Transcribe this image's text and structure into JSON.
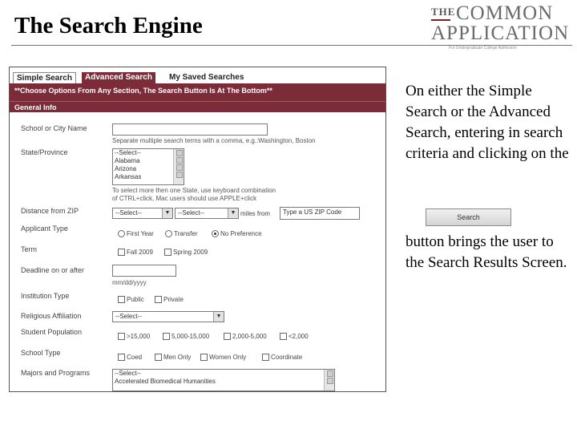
{
  "slide": {
    "title": "The Search Engine",
    "body_part1": "On either the Simple Search or the Advanced Search, entering in search criteria and clicking on the",
    "body_part2": "button brings the user to the Search Results Screen.",
    "search_button_label": "Search"
  },
  "logo": {
    "the": "THE",
    "common": "COMMON",
    "application": "APPLICATION",
    "tagline": "For Undergraduate College Admission"
  },
  "screenshot": {
    "tabs": [
      "Simple Search",
      "Advanced Search",
      "My Saved Searches"
    ],
    "active_tab": "Advanced Search",
    "notice": "**Choose Options From Any Section, The Search Button Is At The Bottom**",
    "section_header": "General Info",
    "labels": {
      "school_or_city": "School or City Name",
      "state": "State/Province",
      "distance": "Distance from ZIP",
      "applicant_type": "Applicant Type",
      "term": "Term",
      "deadline": "Deadline on or after",
      "institution_type": "Institution Type",
      "religious": "Religious Affiliation",
      "student_population": "Student Population",
      "school_type": "School Type",
      "majors": "Majors and Programs"
    },
    "school_hint": "Separate multiple search terms with a comma, e.g.:Washington, Boston",
    "state_options": [
      "--Select--",
      "Alabama",
      "Arizona",
      "Arkansas"
    ],
    "state_hint_line1": "To select more then one State, use keyboard combination",
    "state_hint_line2": "of CTRL+click, Mac users should use APPLE+click",
    "distance_select1": "--Select--",
    "distance_select2": "--Select--",
    "miles_from": "miles from",
    "zip_placeholder": "Type a US ZIP Code",
    "applicant_options": [
      "First Year",
      "Transfer",
      "No Preference"
    ],
    "applicant_selected": "No Preference",
    "term_options": [
      "Fall 2009",
      "Spring 2009"
    ],
    "deadline_format": "mm/dd/yyyy",
    "institution_options": [
      "Public",
      "Private"
    ],
    "religious_select": "--Select--",
    "population_options": [
      ">15,000",
      "5,000-15,000",
      "2,000-5,000",
      "<2,000"
    ],
    "school_type_options": [
      "Coed",
      "Men Only",
      "Women Only",
      "Coordinate"
    ],
    "majors_options": [
      "--Select--",
      "Accelerated Biomedical Humanities"
    ]
  }
}
